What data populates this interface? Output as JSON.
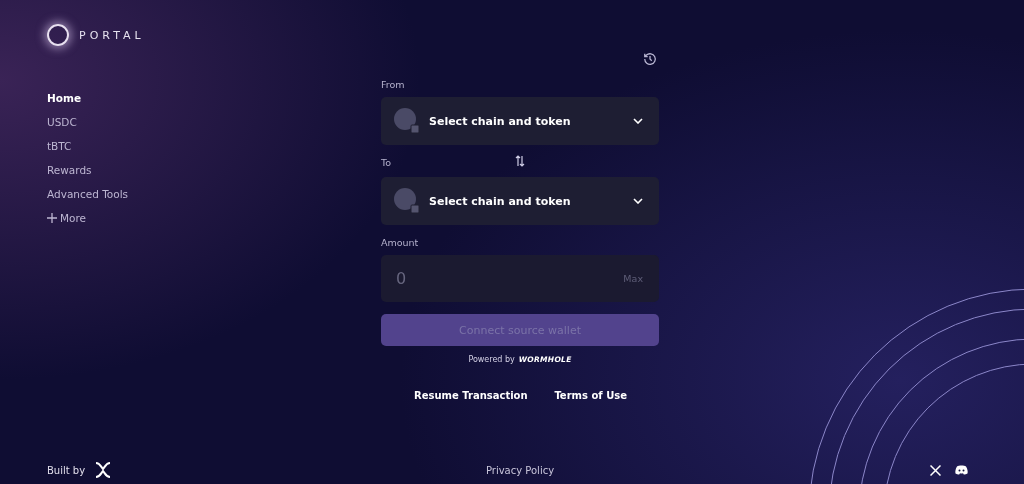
{
  "brand": {
    "name": "PORTAL"
  },
  "nav": [
    {
      "label": "Home",
      "selected": true
    },
    {
      "label": "USDC",
      "selected": false
    },
    {
      "label": "tBTC",
      "selected": false
    },
    {
      "label": "Rewards",
      "selected": false
    },
    {
      "label": "Advanced Tools",
      "selected": false
    },
    {
      "label": "More",
      "selected": false,
      "kind": "more"
    }
  ],
  "form": {
    "from": {
      "label": "From",
      "value": "Select chain and token"
    },
    "to": {
      "label": "To",
      "value": "Select chain and token"
    },
    "amount": {
      "label": "Amount",
      "placeholder": "0",
      "max": "Max"
    },
    "button": {
      "label": "Connect source wallet",
      "disabled": true
    },
    "powered_by": "Powered by",
    "powered_logo": "WORMHOLE"
  },
  "links": [
    "Resume Transaction",
    "Terms of Use"
  ],
  "footer": {
    "built_by": "Built by",
    "center": "Privacy Policy"
  }
}
